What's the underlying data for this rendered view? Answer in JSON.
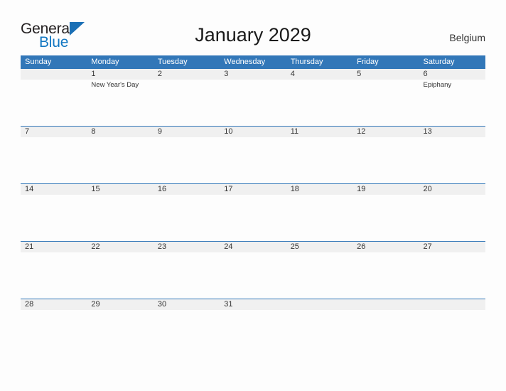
{
  "logo": {
    "word_one": "General",
    "word_two": "Blue",
    "flag_icon": "blue-flag-triangle",
    "dark_color": "#231f20",
    "blue_color": "#1277c2"
  },
  "header": {
    "title": "January 2029",
    "country": "Belgium"
  },
  "theme": {
    "header_blue": "#3277b8",
    "band_gray": "#f0f0f0",
    "page_background": "#fdfdfd",
    "text_color": "#333333"
  },
  "calendar": {
    "weekdays": [
      "Sunday",
      "Monday",
      "Tuesday",
      "Wednesday",
      "Thursday",
      "Friday",
      "Saturday"
    ],
    "weeks": [
      [
        {
          "date": "",
          "event": ""
        },
        {
          "date": "1",
          "event": "New Year's Day"
        },
        {
          "date": "2",
          "event": ""
        },
        {
          "date": "3",
          "event": ""
        },
        {
          "date": "4",
          "event": ""
        },
        {
          "date": "5",
          "event": ""
        },
        {
          "date": "6",
          "event": "Epiphany"
        }
      ],
      [
        {
          "date": "7",
          "event": ""
        },
        {
          "date": "8",
          "event": ""
        },
        {
          "date": "9",
          "event": ""
        },
        {
          "date": "10",
          "event": ""
        },
        {
          "date": "11",
          "event": ""
        },
        {
          "date": "12",
          "event": ""
        },
        {
          "date": "13",
          "event": ""
        }
      ],
      [
        {
          "date": "14",
          "event": ""
        },
        {
          "date": "15",
          "event": ""
        },
        {
          "date": "16",
          "event": ""
        },
        {
          "date": "17",
          "event": ""
        },
        {
          "date": "18",
          "event": ""
        },
        {
          "date": "19",
          "event": ""
        },
        {
          "date": "20",
          "event": ""
        }
      ],
      [
        {
          "date": "21",
          "event": ""
        },
        {
          "date": "22",
          "event": ""
        },
        {
          "date": "23",
          "event": ""
        },
        {
          "date": "24",
          "event": ""
        },
        {
          "date": "25",
          "event": ""
        },
        {
          "date": "26",
          "event": ""
        },
        {
          "date": "27",
          "event": ""
        }
      ],
      [
        {
          "date": "28",
          "event": ""
        },
        {
          "date": "29",
          "event": ""
        },
        {
          "date": "30",
          "event": ""
        },
        {
          "date": "31",
          "event": ""
        },
        {
          "date": "",
          "event": ""
        },
        {
          "date": "",
          "event": ""
        },
        {
          "date": "",
          "event": ""
        }
      ]
    ]
  }
}
